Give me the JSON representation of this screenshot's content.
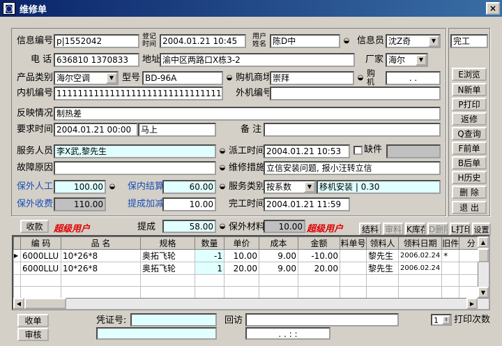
{
  "window": {
    "title": "维修单",
    "close": "×"
  },
  "form": {
    "info_no_label": "信息编号",
    "info_no": "p|1552042",
    "reg_time_label_1": "登记",
    "reg_time_label_2": "时间",
    "reg_time": "2004.01.21 10:45",
    "user_name_label_1": "用户",
    "user_name_label_2": "姓名",
    "user_name": "陈D中",
    "info_src_label": "信息员",
    "info_src": "沈Z奇",
    "status": "完工",
    "phone_label": "电 话",
    "phone": "636810  1370833",
    "address_label": "地址",
    "address": "渝中区两路口X栋3-2",
    "maker_label": "厂家",
    "maker": "海尔",
    "product_label": "产品类别",
    "product": "海尔空调",
    "model_label": "型号",
    "model": "BD-96A",
    "shop_label": "购机商场",
    "shop": "崇拜",
    "buy_label_1": "购",
    "buy_label_2": "机",
    "buy_date": ". .",
    "inner_no_label": "内机编号",
    "inner_no": "1111111111111111111111111111111",
    "outer_no_label": "外机编号",
    "outer_no": "",
    "feedback_label": "反映情况",
    "feedback": "制热差",
    "req_time_label": "要求时间",
    "req_time": "2004.01.21 00:00",
    "req_note": "马上",
    "remark_label": "备 注",
    "remark": "",
    "staff_label": "服务人员",
    "staff": "李X武,黎先生",
    "dispatch_label": "派工时间",
    "dispatch_time": "2004.01.21 10:53",
    "missing_label": "缺件",
    "missing": "",
    "fault_label": "故障原因",
    "fault": "",
    "measure_label": "维修措施",
    "measure": "立信安装问题, 报小汪转立信",
    "out_labor_label": "保外人工",
    "out_labor": "100.00",
    "in_settle_label": "保内结算",
    "in_settle": "60.00",
    "svc_type_label": "服务类别",
    "svc_type": "按系数",
    "svc_detail": "移机安装 | 0.30",
    "out_fee_label": "保外收费",
    "out_fee": "110.00",
    "bonus_label": "提成加减",
    "bonus": "10.00",
    "finish_label": "完工时间",
    "finish_time": "2004.01.21 11:59",
    "collect_btn": "收款",
    "super_user": "超级用户",
    "commission_label": "提成",
    "commission": "58.00",
    "out_material_label": "保外材料",
    "out_material": "10.00"
  },
  "side_buttons": [
    "E浏览",
    "N新单",
    "P打印",
    "返修",
    "Q查询",
    "F前单",
    "B后单",
    "H历史",
    "删 除",
    "退 出"
  ],
  "tool_buttons": [
    "结料",
    "审料",
    "K库存",
    "D删除",
    "L打印",
    "设置"
  ],
  "table": {
    "headers": [
      "编 码",
      "品 名",
      "规格",
      "数量",
      "单价",
      "成本",
      "金额",
      "料单号",
      "领料人",
      "领料日期",
      "旧件",
      "分"
    ],
    "rows": [
      [
        "6000LLU",
        "10*26*8",
        "奥拓飞轮",
        "-1",
        "10.00",
        "9.00",
        "-10.00",
        "",
        "黎先生",
        "2006.02.24",
        "*",
        ""
      ],
      [
        "6000LLU",
        "10*26*8",
        "奥拓飞轮",
        "1",
        "20.00",
        "9.00",
        "20.00",
        "",
        "黎先生",
        "2006.02.24",
        "",
        ""
      ]
    ]
  },
  "footer": {
    "receipt_btn": "收单",
    "audit_btn": "审核",
    "voucher_label": "凭证号:",
    "voucher": "",
    "revisit_label": "回访",
    "revisit": "",
    "revisit_date": ". .   : :",
    "print_count": "1",
    "print_label": "打印次数"
  }
}
